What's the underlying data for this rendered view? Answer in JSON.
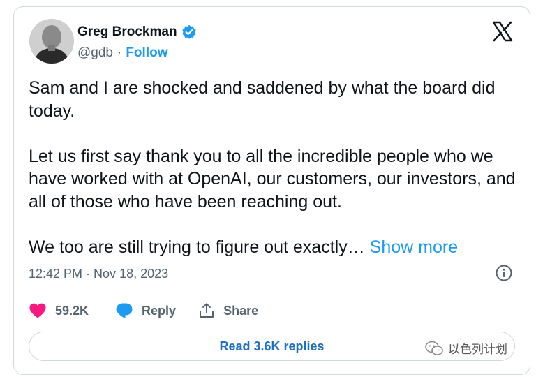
{
  "author": {
    "name": "Greg Brockman",
    "handle": "@gdb",
    "separator": "·",
    "follow_label": "Follow"
  },
  "tweet": {
    "paragraphs": [
      "Sam and I are shocked and saddened by what the board did today.",
      "Let us first say thank you to all the incredible people who we have worked with at OpenAI, our customers, our investors, and all of those who have been reaching out."
    ],
    "truncated_text": "We too are still trying to figure out exactly…",
    "show_more_label": "Show more",
    "timestamp": "12:42 PM · Nov 18, 2023"
  },
  "actions": {
    "likes": "59.2K",
    "reply_label": "Reply",
    "share_label": "Share"
  },
  "replies_button_label": "Read 3.6K replies",
  "watermark_text": "以色列计划",
  "colors": {
    "accent": "#1d9bf0",
    "like": "#f91880",
    "reply_icon": "#1d9bf0",
    "text": "#0f1419",
    "muted": "#536471",
    "border": "#cfd9de"
  },
  "icons": {
    "verified": "verified-badge-icon",
    "logo": "x-logo-icon",
    "info": "info-icon",
    "like": "heart-icon",
    "reply": "speech-bubble-icon",
    "share": "share-upload-icon"
  }
}
